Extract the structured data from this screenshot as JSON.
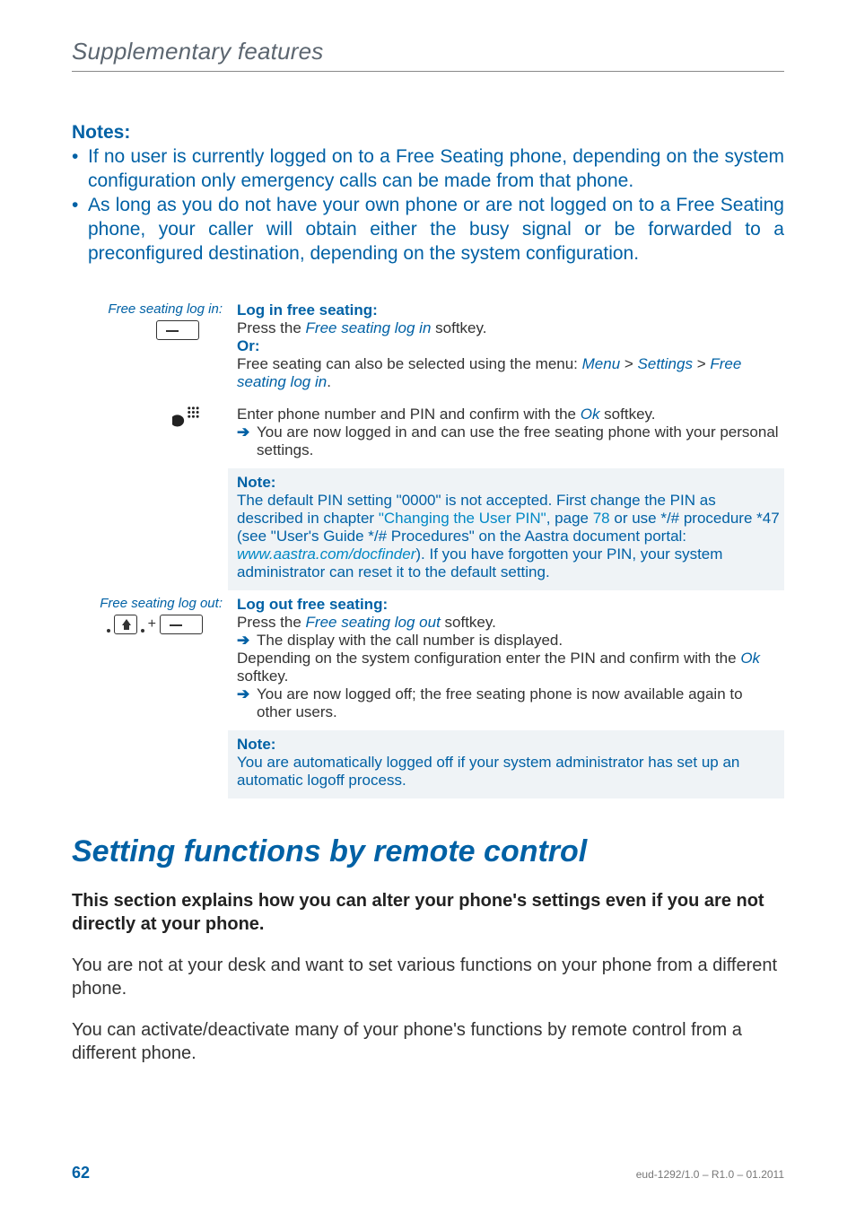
{
  "running_head": "Supplementary features",
  "notes": {
    "title": "Notes:",
    "items": [
      "If no user is currently logged on to a Free Seating phone, depending on the system configuration only emergency calls can be made from that phone.",
      "As long as you do not have your own phone or are not logged on to a Free Seating phone, your caller will obtain either the busy signal or be forwarded to a preconfigured destination, depending on the system configuration."
    ]
  },
  "proc": {
    "row1": {
      "left_caption": "Free seating log in:",
      "title": "Log in free seating:",
      "line1_a": "Press the ",
      "line1_ital": "Free seating log in",
      "line1_b": " softkey.",
      "or": "Or:",
      "line2_a": "Free seating can also be selected using the menu: ",
      "menu": "Menu",
      "sep": " > ",
      "settings": "Settings",
      "free_seat": "Free seating log in",
      "period": "."
    },
    "row2": {
      "line1_a": "Enter phone number and PIN and confirm with the ",
      "ok": "Ok",
      "line1_b": " softkey.",
      "arrow_line": "You are now logged in and can use the free seating phone with your personal settings."
    },
    "row3": {
      "title": "Note:",
      "body_a": "The default PIN setting \"0000\" is not accepted. First change the PIN as described in chapter ",
      "chapter_link": "\"Changing the User PIN\"",
      "body_b": ", page ",
      "page_link": "78",
      "body_c": " or use */# procedure *47 (see \"User's Guide */# Procedures\" on the Aastra document portal: ",
      "url": "www.aastra.com/docfinder",
      "body_d": "). If you have forgotten your PIN, your system administrator can reset it to the default setting."
    },
    "row4": {
      "left_caption": "Free seating log out:",
      "title": "Log out free seating:",
      "line1_a": "Press the ",
      "line1_ital": "Free seating log out",
      "line1_b": " softkey.",
      "arrow_a": "The display with the call number is displayed.",
      "line2_a": "Depending on the system configuration enter the PIN and confirm with the ",
      "ok": "Ok",
      "line2_b": " softkey.",
      "arrow_b": "You are now logged off; the free seating phone is now available again to other users."
    },
    "row5": {
      "title": "Note:",
      "body": "You are automatically logged off if your system administrator has set up an automatic logoff process."
    }
  },
  "section_title": "Setting functions by remote control",
  "lead": "This section explains how you can alter your phone's settings even if you are not directly at your phone.",
  "para1": "You are not at your desk and want to set various functions on your phone from a different phone.",
  "para2": "You can activate/deactivate many of your phone's functions by remote control from a different phone.",
  "footer": {
    "page": "62",
    "docid": "eud-1292/1.0 – R1.0 – 01.2011"
  }
}
